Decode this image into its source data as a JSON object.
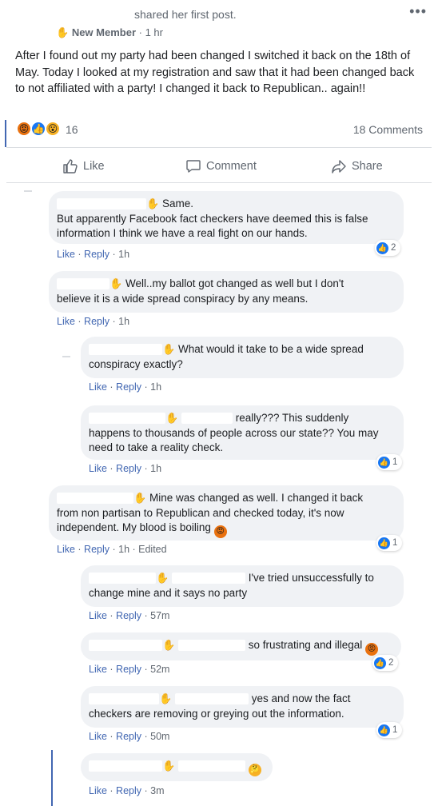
{
  "post": {
    "shared_text": "shared her first post.",
    "badge": "New Member",
    "time": "· 1 hr",
    "menu": "•••",
    "body": "After I found out my party had been changed I switched it back on the 18th of May. Today I looked at my registration and saw that it had been changed back to not affiliated with a party! I changed it back to Republican.. again!!",
    "reaction_count": "16",
    "comments_count": "18 Comments",
    "reaction_icons": [
      "angry-emoji",
      "like-emoji",
      "wow-emoji"
    ]
  },
  "actions": {
    "like": "Like",
    "comment": "Comment",
    "share": "Share"
  },
  "comments": [
    {
      "text_line1": "Same.",
      "text_rest": "But apparently Facebook fact checkers have deemed this is false information I think we have a real fight on our hands.",
      "like": "Like",
      "reply": "Reply",
      "time": "· 1h",
      "likes": "2"
    },
    {
      "text_line1": "Well..my ballot got changed as well but I don't",
      "text_rest": "believe it is a wide spread conspiracy by any means.",
      "like": "Like",
      "reply": "Reply",
      "time": "· 1h"
    },
    {
      "text_line1": "What would it take to be a wide spread",
      "text_rest": "conspiracy exactly?",
      "like": "Like",
      "reply": "Reply",
      "time": "· 1h"
    },
    {
      "text_line1": "really??? This suddenly",
      "text_rest": "happens to thousands of people across our state?? You may need to take a reality check.",
      "like": "Like",
      "reply": "Reply",
      "time": "· 1h",
      "likes": "1"
    },
    {
      "text_line1": "Mine was changed as well. I changed it back",
      "text_rest": "from non partisan to Republican and checked today, it's now independent. My blood is boiling",
      "like": "Like",
      "reply": "Reply",
      "time": "· 1h · Edited",
      "likes": "1"
    },
    {
      "text_line1": "I've tried unsuccessfully to",
      "text_rest": "change mine and it says no party",
      "like": "Like",
      "reply": "Reply",
      "time": "· 57m"
    },
    {
      "text_line1": "so frustrating and illegal",
      "like": "Like",
      "reply": "Reply",
      "time": "· 52m",
      "likes": "2"
    },
    {
      "text_line1": "yes and now the fact",
      "text_rest": "checkers are removing or greying out the information.",
      "like": "Like",
      "reply": "Reply",
      "time": "· 50m",
      "likes": "1"
    },
    {
      "like": "Like",
      "reply": "Reply",
      "time": "· 3m"
    }
  ],
  "colors": {
    "accent": "#4267b2",
    "like_blue": "#1877f2",
    "bubble": "#f0f2f5",
    "muted": "#606770"
  }
}
